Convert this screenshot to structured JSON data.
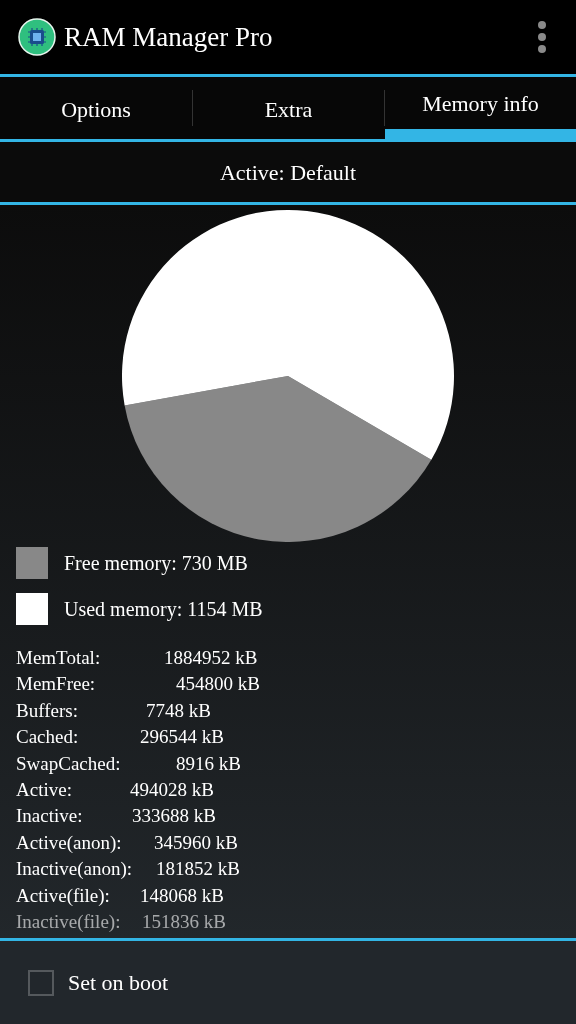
{
  "app_bar": {
    "title": "RAM Manager Pro"
  },
  "tabs": [
    {
      "label": "Options",
      "selected": false
    },
    {
      "label": "Extra",
      "selected": false
    },
    {
      "label": "Memory info",
      "selected": true
    }
  ],
  "profile": {
    "label": "Active: Default"
  },
  "memory_chart": {
    "chart_data": {
      "type": "pie",
      "values": [
        38.75,
        61.25
      ],
      "colors": [
        "#888888",
        "#ffffff"
      ]
    }
  },
  "legend": [
    {
      "label": "Free memory: 730 MB",
      "color": "#888888"
    },
    {
      "label": "Used memory: 1154 MB",
      "color": "#ffffff"
    }
  ],
  "meminfo": [
    {
      "name": "MemTotal:",
      "value": "1884952 kB"
    },
    {
      "name": "MemFree:",
      "value": "454800 kB"
    },
    {
      "name": "Buffers:",
      "value": "7748 kB"
    },
    {
      "name": "Cached:",
      "value": "296544 kB"
    },
    {
      "name": "SwapCached:",
      "value": "8916 kB"
    },
    {
      "name": "Active:",
      "value": "494028 kB"
    },
    {
      "name": "Inactive:",
      "value": "333688 kB"
    },
    {
      "name": "Active(anon):",
      "value": "345960 kB"
    },
    {
      "name": "Inactive(anon):",
      "value": "181852 kB"
    },
    {
      "name": "Active(file):",
      "value": "148068 kB"
    },
    {
      "name": "Inactive(file):",
      "value": "151836 kB"
    }
  ],
  "set_on_boot": {
    "label": "Set on boot",
    "checked": false
  }
}
